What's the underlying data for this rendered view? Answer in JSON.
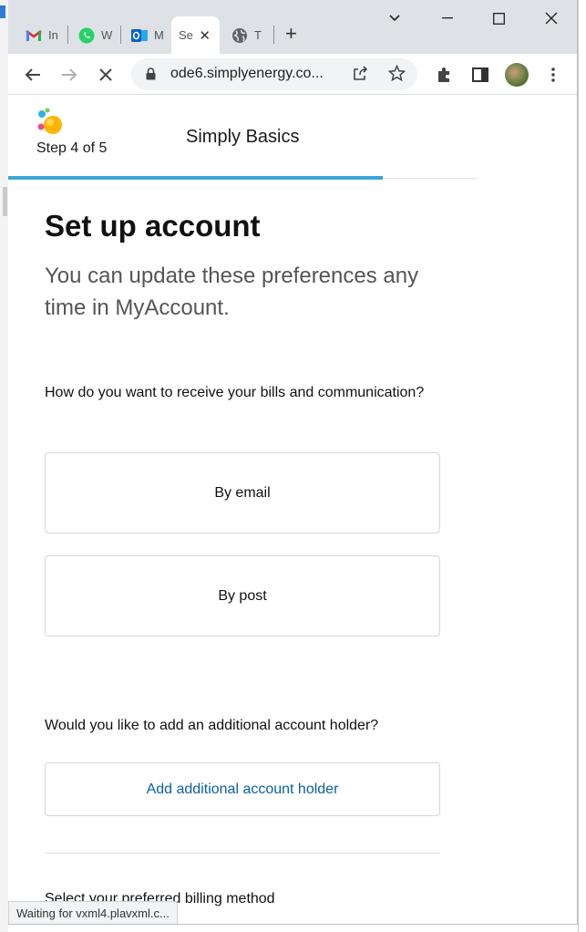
{
  "browser": {
    "tabs": [
      {
        "title": "In",
        "icon": "gmail-icon"
      },
      {
        "title": "W",
        "icon": "whatsapp-icon"
      },
      {
        "title": "M",
        "icon": "outlook-icon"
      },
      {
        "title": "Se",
        "icon": "",
        "active": true
      },
      {
        "title": "T",
        "icon": "globe-icon"
      }
    ],
    "new_tab": "+",
    "url": "ode6.simplyenergy.co...",
    "status_text": "Waiting for vxml4.plavxml.c..."
  },
  "page": {
    "step_label": "Step 4 of 5",
    "progress": 0.8,
    "plan_name": "Simply Basics",
    "title": "Set up account",
    "subtitle": "You can update these preferences any time in MyAccount.",
    "q1": "How do you want to receive your bills and communication?",
    "options": [
      "By email",
      "By post"
    ],
    "q2": "Would you like to add an additional account holder?",
    "add_holder_label": "Add additional account holder",
    "q3": "Select your preferred billing method"
  },
  "colors": {
    "accent": "#3aa6d6",
    "link": "#0a5fa8",
    "tabstrip": "#dee1e6"
  }
}
